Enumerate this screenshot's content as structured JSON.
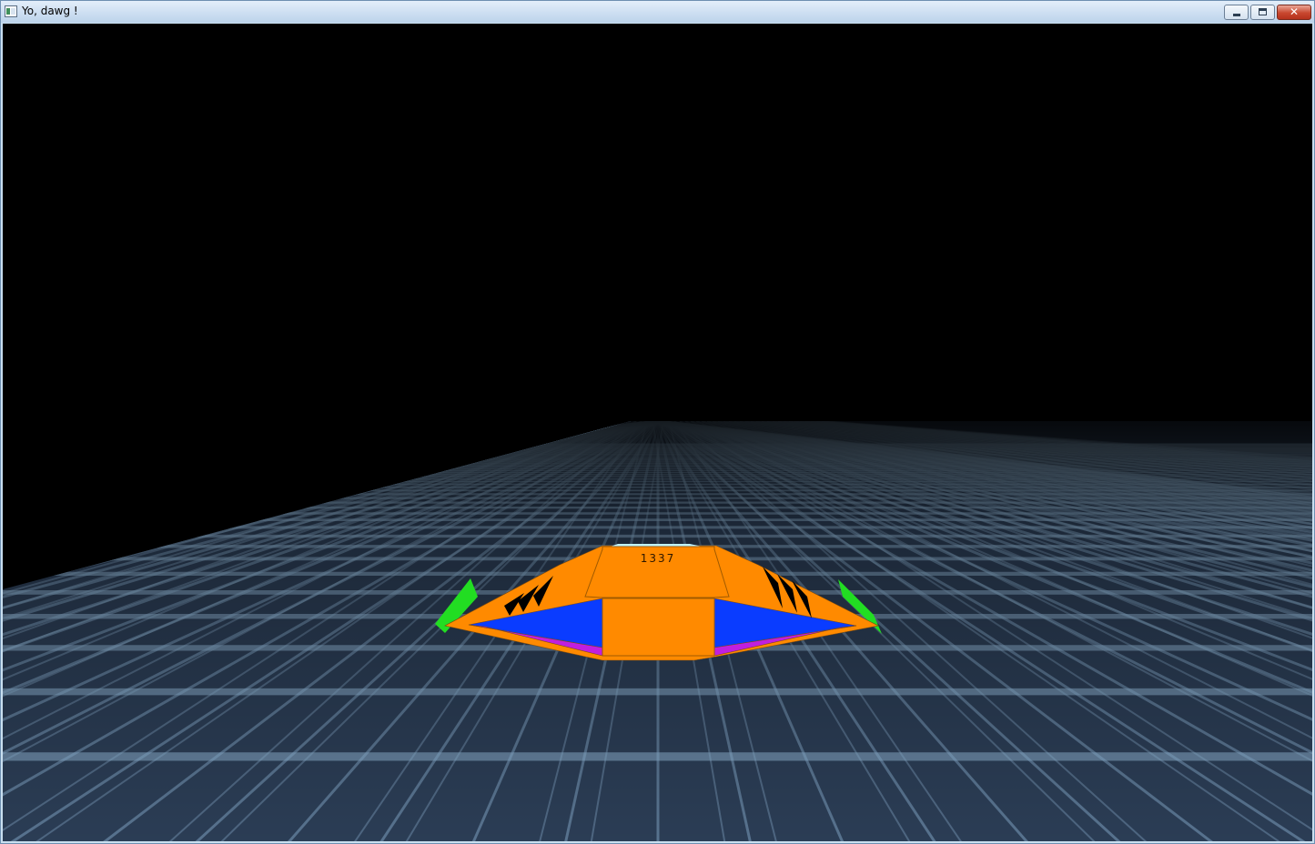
{
  "window": {
    "title": "Yo, dawg !",
    "controls": {
      "minimize_icon": "minimize-icon",
      "maximize_icon": "maximize-icon",
      "close_icon": "close-icon",
      "close_glyph": "✕"
    }
  },
  "scene": {
    "background_color": "#000000",
    "floor_color": "#2b3d55",
    "floor_line_color": "#8fb4d4",
    "ship": {
      "number": "1337",
      "body_color": "#ff8a00",
      "panel_color": "#0a3cff",
      "trim_color": "#c01fe0",
      "fin_color": "#22dd22",
      "canopy_color": "#bff4ff"
    }
  }
}
